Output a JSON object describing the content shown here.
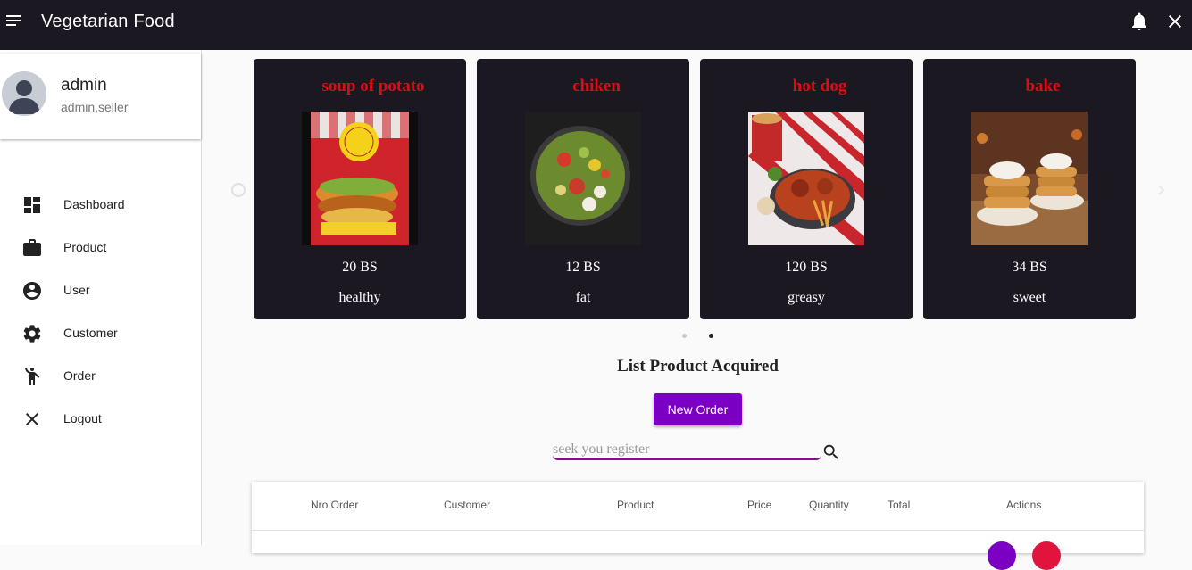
{
  "header": {
    "title": "Vegetarian Food",
    "menu_icon": "menu-icon",
    "bell_icon": "bell-icon",
    "close_icon": "close-icon",
    "bg_color": "#1c1822"
  },
  "profile": {
    "name": "admin",
    "role": "admin,seller"
  },
  "sidebar": {
    "items": [
      {
        "label": "Dashboard",
        "icon": "dashboard-icon"
      },
      {
        "label": "Product",
        "icon": "briefcase-icon"
      },
      {
        "label": "User",
        "icon": "account-circle-icon"
      },
      {
        "label": "Customer",
        "icon": "gear-icon"
      },
      {
        "label": "Order",
        "icon": "person-standing-icon"
      },
      {
        "label": "Logout",
        "icon": "close-icon"
      }
    ]
  },
  "carousel": {
    "cards": [
      {
        "title": "soup of potato",
        "price": "20 BS",
        "desc": "healthy"
      },
      {
        "title": "chiken",
        "price": "12 BS",
        "desc": "fat"
      },
      {
        "title": "hot dog",
        "price": "120 BS",
        "desc": "greasy"
      },
      {
        "title": "bake",
        "price": "34 BS",
        "desc": "sweet"
      }
    ],
    "title_color": "#e50914",
    "active_page": 2,
    "page_count": 2
  },
  "orders": {
    "title": "List Product Acquired",
    "new_order_label": "New Order",
    "search_placeholder": "seek you register",
    "accent_color": "#7b00c4",
    "columns": [
      "Nro Order",
      "Customer",
      "Product",
      "Price",
      "Quantity",
      "Total",
      "Actions"
    ]
  }
}
